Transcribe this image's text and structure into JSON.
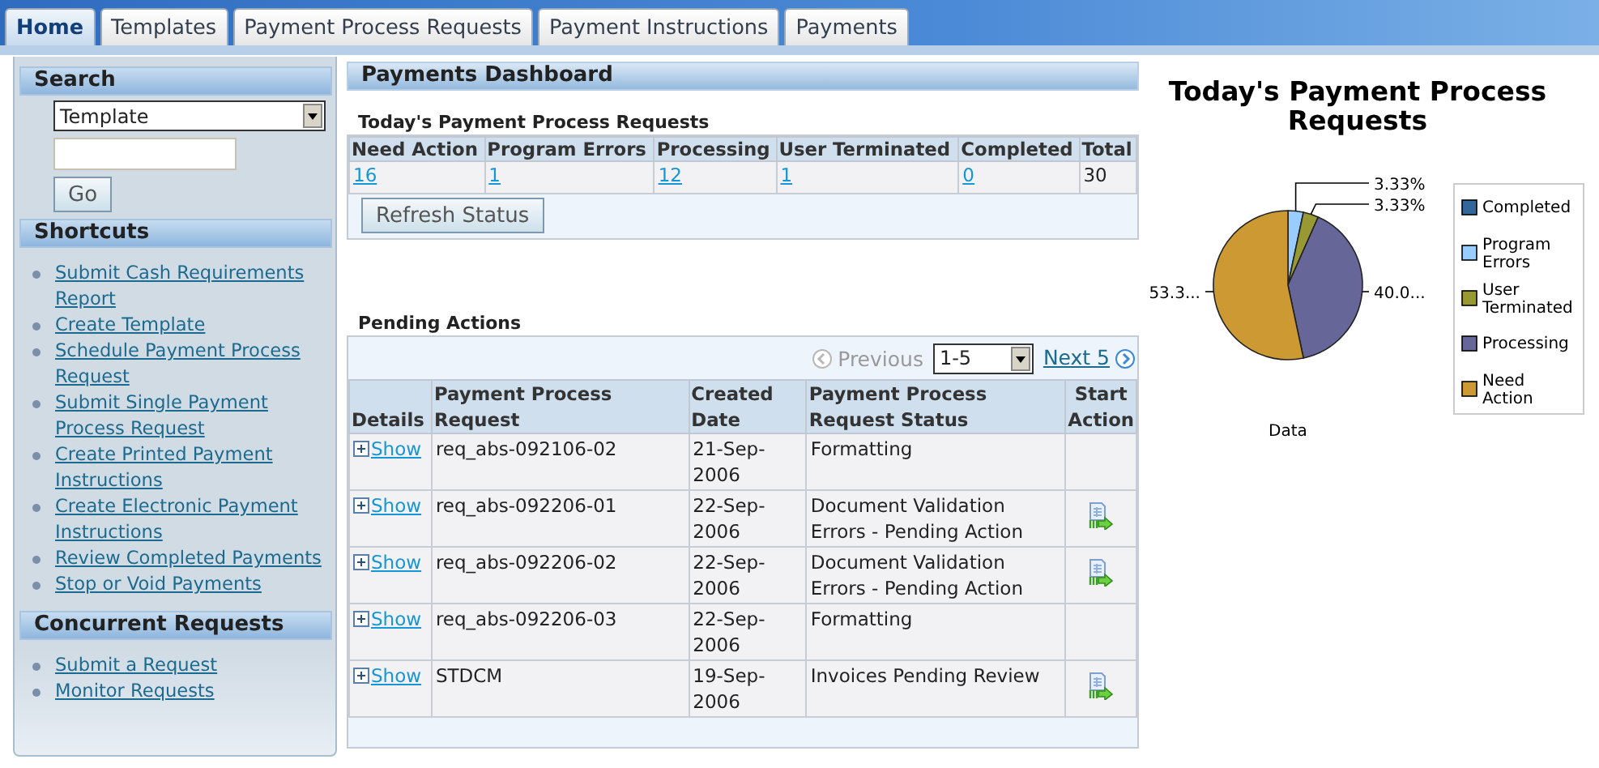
{
  "tabs": [
    {
      "label": "Home",
      "selected": true
    },
    {
      "label": "Templates",
      "selected": false
    },
    {
      "label": "Payment Process Requests",
      "selected": false
    },
    {
      "label": "Payment Instructions",
      "selected": false
    },
    {
      "label": "Payments",
      "selected": false
    }
  ],
  "sidebar": {
    "sections": [
      {
        "title": "Search",
        "kind": "search",
        "select": "Template",
        "button": "Go"
      },
      {
        "title": "Shortcuts",
        "kind": "links",
        "items": [
          "Submit Cash Requirements Report",
          "Create Template",
          "Schedule Payment Process Request",
          "Submit Single Payment Process Request",
          "Create Printed Payment Instructions",
          "Create Electronic Payment Instructions",
          "Review Completed Payments",
          "Stop or Void Payments"
        ]
      },
      {
        "title": "Concurrent Requests",
        "kind": "links",
        "items": [
          "Submit a Request",
          "Monitor Requests"
        ]
      }
    ]
  },
  "dashboard": {
    "title": "Payments Dashboard",
    "summary": {
      "title": "Today's Payment Process Requests",
      "columns": [
        "Need Action",
        "Program Errors",
        "Processing",
        "User Terminated",
        "Completed",
        "Total"
      ],
      "values": [
        {
          "text": "16",
          "link": true
        },
        {
          "text": "1",
          "link": true
        },
        {
          "text": "12",
          "link": true
        },
        {
          "text": "1",
          "link": true
        },
        {
          "text": "0",
          "link": true
        },
        {
          "text": "30",
          "link": false
        }
      ],
      "button": "Refresh Status"
    },
    "pending": {
      "title": "Pending Actions",
      "nav": {
        "previous": "Previous",
        "previous_disabled": true,
        "range": "1-5",
        "next": "Next 5"
      },
      "columns": [
        "Details",
        "Payment Process Request",
        "Created Date",
        "Payment Process Request Status",
        "Start Action"
      ],
      "rows": [
        {
          "details": "Show",
          "request": "req_abs-092106-02",
          "date": "21-Sep-2006",
          "status": "Formatting",
          "start_action": false
        },
        {
          "details": "Show",
          "request": "req_abs-092206-01",
          "date": "22-Sep-2006",
          "status": "Document Validation Errors - Pending Action",
          "start_action": true
        },
        {
          "details": "Show",
          "request": "req_abs-092206-02",
          "date": "22-Sep-2006",
          "status": "Document Validation Errors - Pending Action",
          "start_action": true
        },
        {
          "details": "Show",
          "request": "req_abs-092206-03",
          "date": "22-Sep-2006",
          "status": "Formatting",
          "start_action": false
        },
        {
          "details": "Show",
          "request": "STDCM",
          "date": "19-Sep-2006",
          "status": "Invoices Pending Review",
          "start_action": true
        }
      ]
    }
  },
  "chart": {
    "chart_data": {
      "type": "pie",
      "title": "Today's Payment Process Requests",
      "legend": true,
      "categories": [
        "Completed",
        "Program Errors",
        "User Terminated",
        "Processing",
        "Need Action"
      ],
      "series": [
        {
          "name": "Data",
          "colors": [
            "#336699",
            "#99ccff",
            "#999933",
            "#666699",
            "#cc9933"
          ],
          "values": [
            0,
            3.33,
            3.33,
            40.0,
            53.33
          ]
        }
      ],
      "value_labels": [
        null,
        "3.33%",
        "3.33%",
        "40.0...",
        "53.3..."
      ]
    }
  }
}
